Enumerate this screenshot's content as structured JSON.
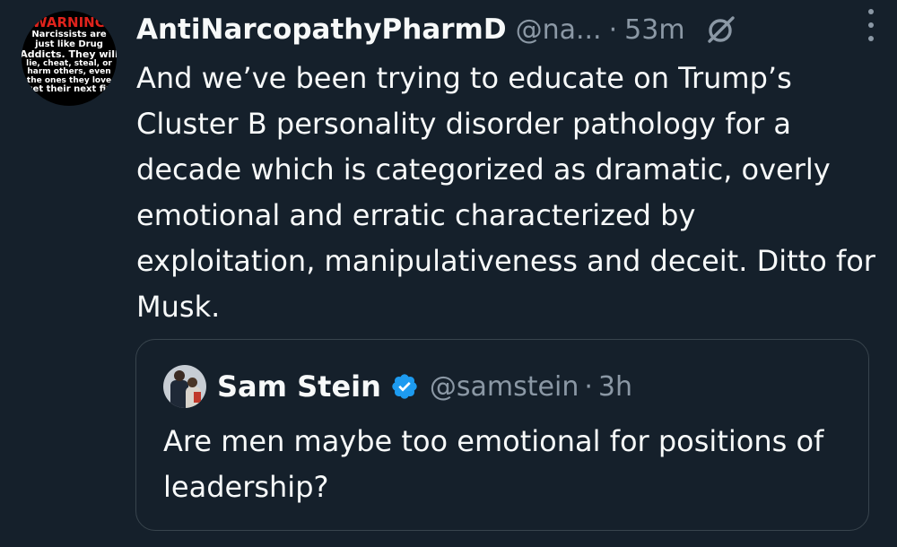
{
  "tweet": {
    "author_name": "AntiNarcopathyPharmD",
    "handle": "@na...",
    "separator": "·",
    "time": "53m",
    "avatar_text": {
      "warning": "WARNING",
      "line1": "Narcissists are",
      "line2": "just like Drug",
      "line3": "Addicts. They will",
      "line4": "lie, cheat, steal, or",
      "line5": "harm others, even",
      "line6": "the ones they love",
      "line7": "get their next fix"
    },
    "icons": {
      "grok": "grok-icon",
      "more": "more-options-icon"
    },
    "text": "And we’ve been trying to educate on Trump’s Cluster B personality disorder pathology for a decade which is categorized as dramatic, overly emotional and erratic characterized by exploitation, manipulativeness and deceit. Ditto for Musk."
  },
  "quote": {
    "author_name": "Sam Stein",
    "handle": "@samstein",
    "separator": "·",
    "time": "3h",
    "verified_color": "#1d9bf0",
    "text": "Are men maybe too emotional for positions of leadership?"
  },
  "colors": {
    "background": "#15202b",
    "text": "#f7f9f9",
    "muted": "#8b98a5",
    "border": "#38444d"
  }
}
